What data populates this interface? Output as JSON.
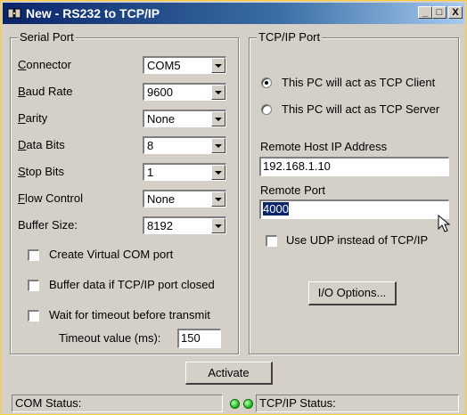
{
  "window": {
    "title": "New - RS232 to TCP/IP",
    "controls": {
      "minimize": "_",
      "maximize": "□",
      "close": "X"
    }
  },
  "serial": {
    "legend": "Serial Port",
    "fields": [
      {
        "label": "Connector",
        "value": "COM5"
      },
      {
        "label": "Baud Rate",
        "value": "9600"
      },
      {
        "label": "Parity",
        "value": "None"
      },
      {
        "label": "Data Bits",
        "value": "8"
      },
      {
        "label": "Stop Bits",
        "value": "1"
      },
      {
        "label": "Flow Control",
        "value": "None"
      },
      {
        "label": "Buffer Size:",
        "value": "8192"
      }
    ],
    "checkboxes": [
      {
        "label": "Create Virtual COM port",
        "checked": false
      },
      {
        "label": "Buffer data if TCP/IP port closed",
        "checked": false
      },
      {
        "label": "Wait for timeout before transmit",
        "checked": false
      }
    ],
    "timeout_label": "Timeout value (ms):",
    "timeout_value": "150"
  },
  "tcp": {
    "legend": "TCP/IP Port",
    "radios": [
      {
        "label": "This PC will act as TCP Client",
        "selected": true
      },
      {
        "label": "This PC will act as TCP Server",
        "selected": false
      }
    ],
    "host_label": "Remote Host IP Address",
    "host_value": "192.168.1.10",
    "port_label": "Remote Port",
    "port_value": "4000",
    "udp_label": "Use UDP instead of TCP/IP",
    "io_button": "I/O Options..."
  },
  "activate_button": "Activate",
  "status": {
    "com": "COM Status:",
    "tcp": "TCP/IP Status:"
  },
  "colors": {
    "window_border": "#ffcc33",
    "titlebar": "#0a246a",
    "selection": "#0a246a",
    "led": "#19b219"
  }
}
